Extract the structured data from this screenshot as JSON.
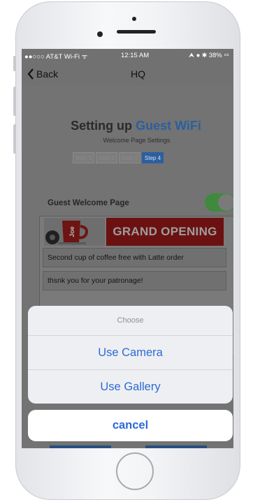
{
  "status_bar": {
    "carrier": "●●○○○ AT&T Wi-Fi ᯤ",
    "time": "12:15 AM",
    "right": "⮝ ● ✱ 38% ▭"
  },
  "nav": {
    "back_label": "Back",
    "title": "HQ"
  },
  "page": {
    "heading_prefix": "Setting up",
    "heading_accent": "Guest WiFi",
    "subheading": "Welcome Page Settings",
    "steps": [
      "Step 1",
      "Step 2",
      "Step 3",
      "Step 4"
    ],
    "active_step": "Step 4"
  },
  "welcome": {
    "label": "Guest Welcome Page",
    "toggle_on": true,
    "banner_text": "GRAND OPENING",
    "mug_text": "Joe",
    "message_1": "Second cup of coffee free with Latte order",
    "message_2": "thsnk you for your patronage!"
  },
  "action_sheet": {
    "title": "Choose",
    "options": [
      "Use Camera",
      "Use Gallery"
    ],
    "cancel_label": "cancel"
  },
  "colors": {
    "accent": "#2c6ad8",
    "step_active": "#2c5fa0",
    "toggle_on": "#3f8a3c",
    "banner_red": "#6b1111"
  }
}
